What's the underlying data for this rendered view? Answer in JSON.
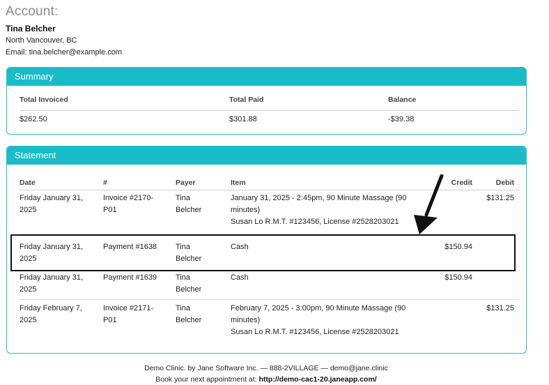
{
  "account": {
    "heading": "Account:",
    "name": "Tina Belcher",
    "city": "North Vancouver, BC",
    "email": "Email: tina.belcher@example.com"
  },
  "summary": {
    "title": "Summary",
    "headers": [
      "Total Invoiced",
      "Total Paid",
      "Balance"
    ],
    "values": [
      "$262.50",
      "$301.88",
      "-$39.38"
    ]
  },
  "statement": {
    "title": "Statement",
    "headers": {
      "date": "Date",
      "num": "#",
      "payer": "Payer",
      "item": "Item",
      "credit": "Credit",
      "debit": "Debit"
    },
    "rows": [
      {
        "date": [
          "Friday January 31,",
          "2025"
        ],
        "num": [
          "Invoice #2170-",
          "P01"
        ],
        "payer": [
          "Tina",
          "Belcher"
        ],
        "item": [
          "January 31, 2025 - 2:45pm, 90 Minute Massage (90",
          "minutes)",
          "Susan Lo R.M.T. #123456, License #2528203021"
        ],
        "credit": "",
        "debit": "$131.25"
      },
      {
        "date": [
          "Friday January 31,",
          "2025"
        ],
        "num": [
          "Payment #1638",
          ""
        ],
        "payer": [
          "Tina",
          "Belcher"
        ],
        "item": [
          "Cash",
          "",
          ""
        ],
        "credit": "$150.94",
        "debit": ""
      },
      {
        "date": [
          "Friday January 31,",
          "2025"
        ],
        "num": [
          "Payment #1639",
          ""
        ],
        "payer": [
          "Tina",
          "Belcher"
        ],
        "item": [
          "Cash",
          "",
          ""
        ],
        "credit": "$150.94",
        "debit": ""
      },
      {
        "date": [
          "Friday February 7,",
          "2025"
        ],
        "num": [
          "Invoice #2171-",
          "P01"
        ],
        "payer": [
          "Tina",
          "Belcher"
        ],
        "item": [
          "February 7, 2025 - 3:00pm, 90 Minute Massage (90",
          "minutes)",
          "Susan Lo R.M.T. #123456, License #2528203021"
        ],
        "credit": "",
        "debit": "$131.25"
      }
    ]
  },
  "footer": {
    "line1": "Demo Clinic. by Jane Software Inc. — 888-2VILLAGE — demo@jane.clinic",
    "line2_prefix": "Book your next appointment at: ",
    "link": "http://demo-cac1-20.janeapp.com/"
  },
  "annotation": {
    "highlight_color": "#111111",
    "arrow_color": "#111111"
  }
}
